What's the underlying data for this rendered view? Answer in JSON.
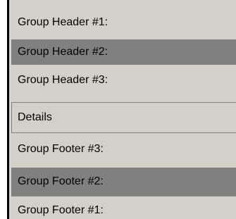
{
  "bands": {
    "group_header_1": "Group Header #1:",
    "group_header_2": "Group Header #2:",
    "group_header_3": "Group Header #3:",
    "details": "Details",
    "group_footer_3": "Group Footer #3:",
    "group_footer_2": "Group Footer #2:",
    "group_footer_1": "Group Footer #1:"
  },
  "colors": {
    "panel": "#d4d0c8",
    "highlight_band": "#808080",
    "border": "#808080"
  }
}
